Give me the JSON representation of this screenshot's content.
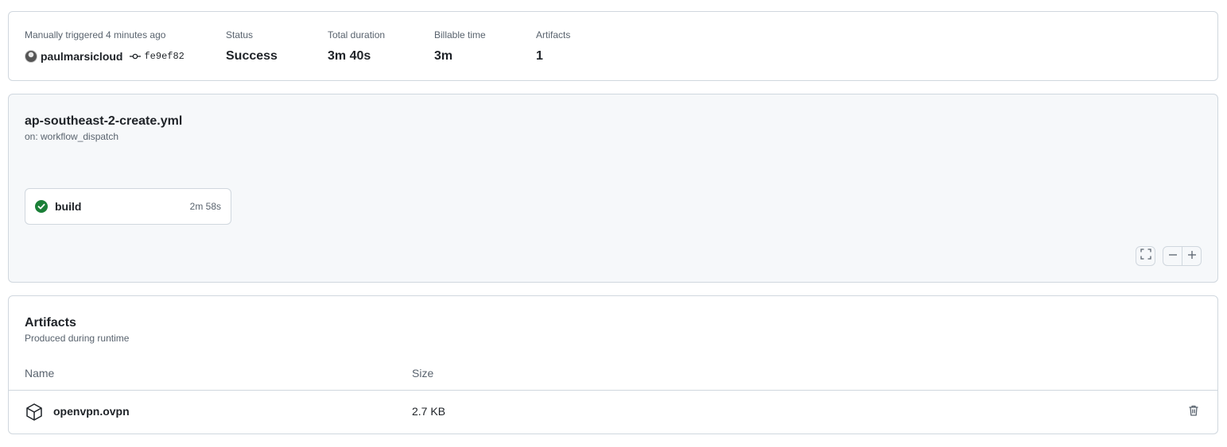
{
  "summary": {
    "trigger_label": "Manually triggered 4 minutes ago",
    "actor": "paulmarsicloud",
    "commit": "fe9ef82",
    "status_label": "Status",
    "status_value": "Success",
    "duration_label": "Total duration",
    "duration_value": "3m 40s",
    "billable_label": "Billable time",
    "billable_value": "3m",
    "artifacts_label": "Artifacts",
    "artifacts_value": "1"
  },
  "workflow": {
    "file": "ap-southeast-2-create.yml",
    "trigger": "on: workflow_dispatch",
    "jobs": [
      {
        "name": "build",
        "duration": "2m 58s",
        "status": "success",
        "status_color": "#1a7f37"
      }
    ]
  },
  "artifacts": {
    "title": "Artifacts",
    "subtitle": "Produced during runtime",
    "columns": {
      "name": "Name",
      "size": "Size"
    },
    "rows": [
      {
        "name": "openvpn.ovpn",
        "size": "2.7 KB"
      }
    ]
  }
}
